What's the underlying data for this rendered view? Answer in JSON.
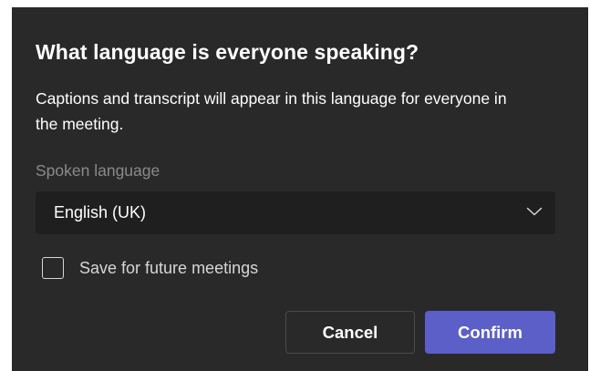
{
  "dialog": {
    "title": "What language is everyone speaking?",
    "description": "Captions and transcript will appear in this language for everyone in the meeting.",
    "field_label": "Spoken language",
    "language_select": {
      "selected_value": "English (UK)",
      "icon": "chevron-down-icon"
    },
    "save_checkbox": {
      "label": "Save for future meetings",
      "checked": false
    },
    "buttons": {
      "cancel": "Cancel",
      "confirm": "Confirm"
    },
    "colors": {
      "background": "#292929",
      "select_background": "#1f1f1f",
      "primary": "#5b5fc7",
      "muted_text": "#8a8a8a"
    }
  }
}
